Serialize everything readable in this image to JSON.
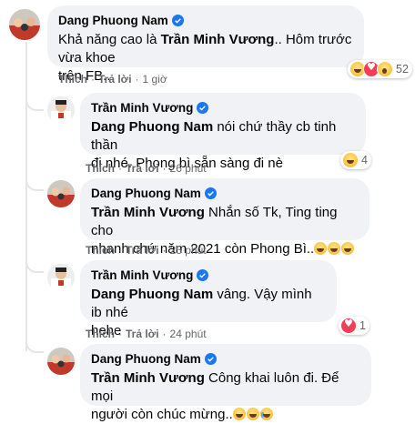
{
  "colors": {
    "verified": "#1877f2",
    "bubble": "#f0f2f5",
    "meta": "#65676b",
    "thread": "#e4e6eb"
  },
  "comments": [
    {
      "author": "Dang Phuong Nam",
      "text_line1_pre": "Khả năng cao là ",
      "text_line1_mention": "Trần Minh Vương",
      "text_line1_post": ".. Hôm trước vừa khoe",
      "text_line2": "trên FB..",
      "like": "Thích",
      "reply": "Trả lời",
      "time": "1 giờ",
      "reactions": [
        "haha-icon",
        "love-icon",
        "wow-icon"
      ],
      "reaction_count": "52"
    },
    {
      "author": "Trần Minh Vương",
      "mention": "Dang Phuong Nam",
      "text_line1_post": " nói chứ thầy cb tinh thần",
      "text_line2": "đi nhé. Phong bì sẵn sàng đi nè",
      "like": "Thích",
      "reply": "Trả lời",
      "time": "26 phút",
      "reactions": [
        "haha-icon"
      ],
      "reaction_count": "4"
    },
    {
      "author": "Dang Phuong Nam",
      "mention": "Trần Minh Vương",
      "text_line1_post": " Nhắn số Tk, Ting ting cho",
      "text_line2": "nhanh chứ năm 2021 còn Phong Bì..",
      "like": "Thích",
      "reply": "Trả lời",
      "time": "25 phút"
    },
    {
      "author": "Trần Minh Vương",
      "mention": "Dang Phuong Nam",
      "text_line1_post": " vâng. Vậy mình ib nhé",
      "text_line2": "hehe",
      "like": "Thích",
      "reply": "Trả lời",
      "time": "24 phút",
      "reactions": [
        "love-icon"
      ],
      "reaction_count": "1"
    },
    {
      "author": "Dang Phuong Nam",
      "mention": "Trần Minh Vương",
      "text_line1_post": " Công khai luôn đi. Để mọi",
      "text_line2": "người còn chúc mừng.."
    }
  ]
}
